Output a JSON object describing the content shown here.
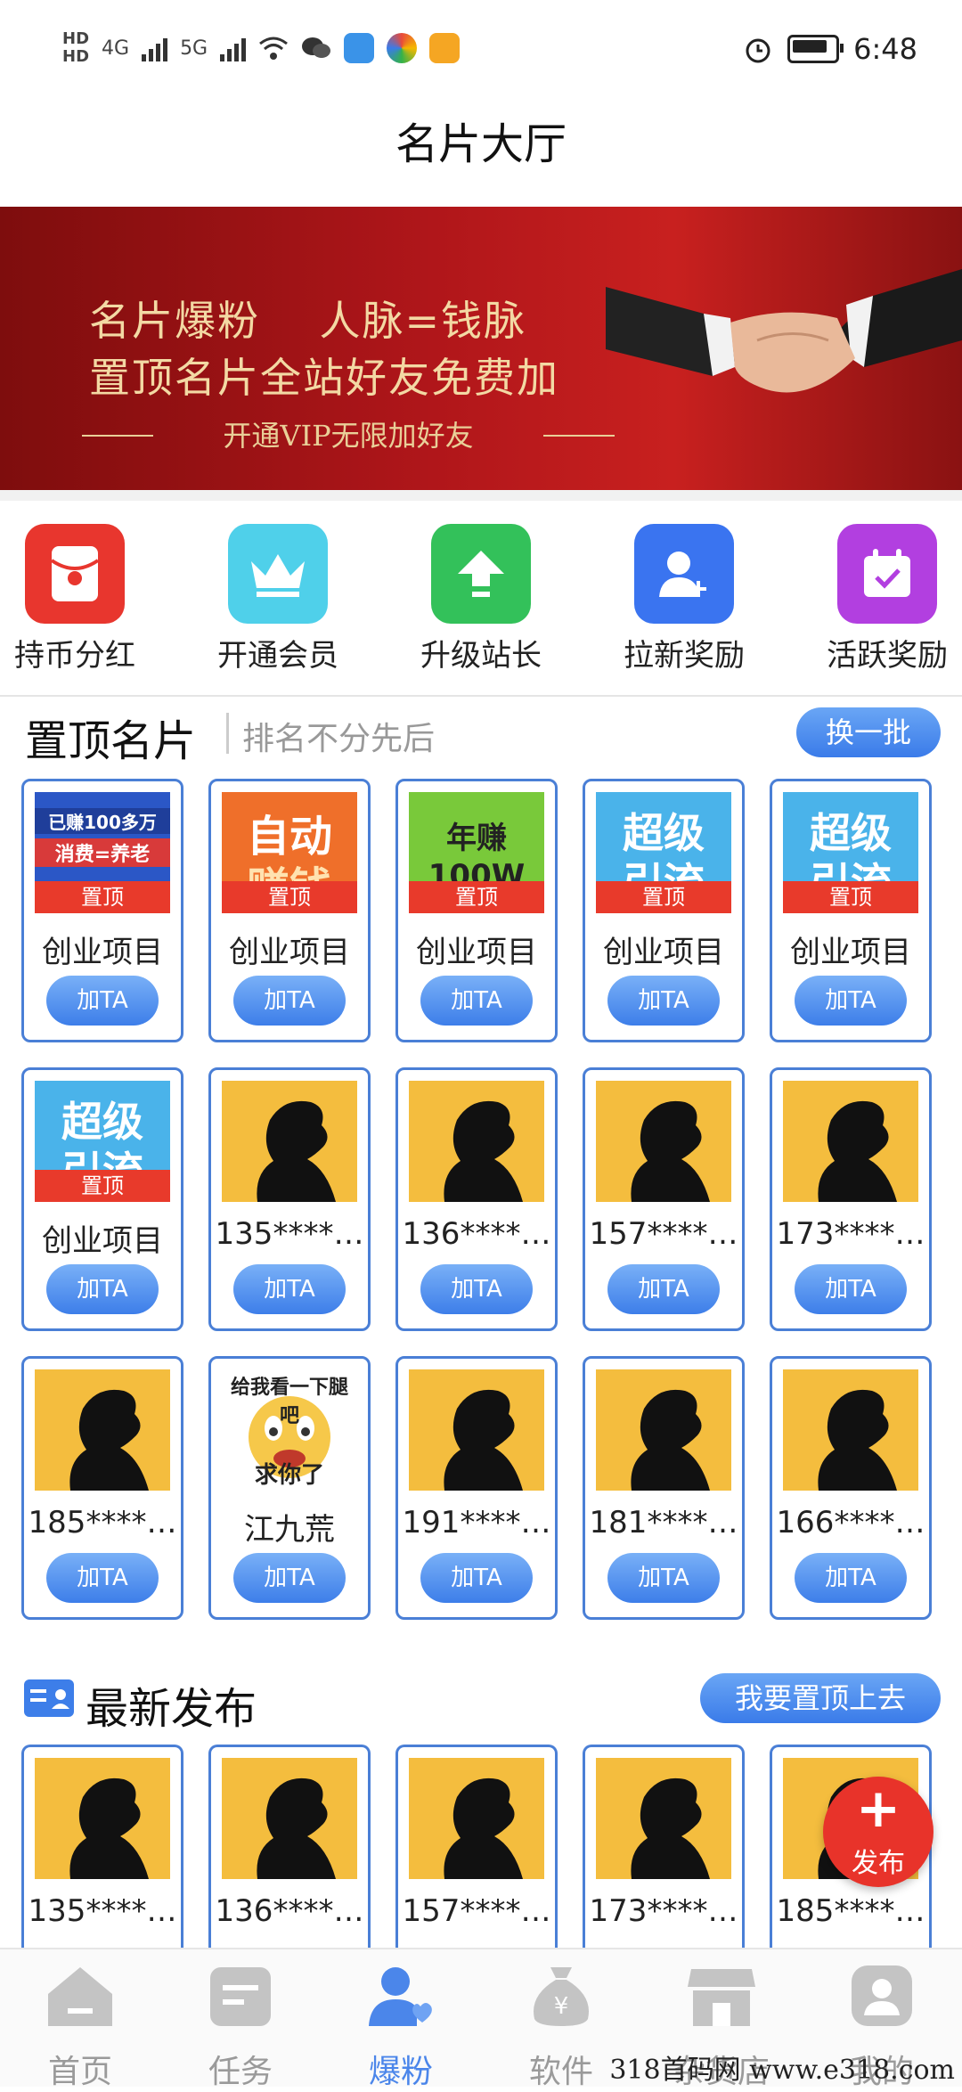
{
  "status_bar": {
    "hd1": "HD",
    "hd2": "HD",
    "net1": "4G",
    "net2": "5G",
    "time": "6:48"
  },
  "header": {
    "title": "名片大厅"
  },
  "banner": {
    "line1": "名片爆粉    人脉=钱脉",
    "line2": "置顶名片全站好友免费加",
    "line3": "开通VIP无限加好友"
  },
  "quick_actions": [
    {
      "label": "持币分红",
      "icon": "red-envelope-icon",
      "color": "#e8362e"
    },
    {
      "label": "开通会员",
      "icon": "crown-icon",
      "color": "#4fd0ea"
    },
    {
      "label": "升级站长",
      "icon": "upgrade-arrow-icon",
      "color": "#33c15a"
    },
    {
      "label": "拉新奖励",
      "icon": "add-user-icon",
      "color": "#3a74f0"
    },
    {
      "label": "活跃奖励",
      "icon": "calendar-check-icon",
      "color": "#b23fe0"
    }
  ],
  "pinned": {
    "title": "置顶名片",
    "subtitle": "排名不分先后",
    "refresh_label": "换一批",
    "cards": [
      {
        "name": "创业项目",
        "pinned_tag": "置顶",
        "add_label": "加TA",
        "promo": "已赚100多万 消费=养老"
      },
      {
        "name": "创业项目",
        "pinned_tag": "置顶",
        "add_label": "加TA",
        "promo": "自动赚钱"
      },
      {
        "name": "创业项目",
        "pinned_tag": "置顶",
        "add_label": "加TA",
        "promo": "年赚100W"
      },
      {
        "name": "创业项目",
        "pinned_tag": "置顶",
        "add_label": "加TA",
        "promo": "超级引流"
      },
      {
        "name": "创业项目",
        "pinned_tag": "置顶",
        "add_label": "加TA",
        "promo": "超级引流"
      },
      {
        "name": "创业项目",
        "pinned_tag": "置顶",
        "add_label": "加TA",
        "promo": "超级引流"
      },
      {
        "name": "135****…",
        "add_label": "加TA"
      },
      {
        "name": "136****…",
        "add_label": "加TA"
      },
      {
        "name": "157****…",
        "add_label": "加TA"
      },
      {
        "name": "173****…",
        "add_label": "加TA"
      },
      {
        "name": "185****…",
        "add_label": "加TA"
      },
      {
        "name": "江九荒",
        "add_label": "加TA",
        "promo": "给我看一下腿吧 求你了"
      },
      {
        "name": "191****…",
        "add_label": "加TA"
      },
      {
        "name": "181****…",
        "add_label": "加TA"
      },
      {
        "name": "166****…",
        "add_label": "加TA"
      }
    ]
  },
  "latest": {
    "title": "最新发布",
    "pin_cta": "我要置顶上去",
    "cards": [
      {
        "name": "135****…"
      },
      {
        "name": "136****…"
      },
      {
        "name": "157****…"
      },
      {
        "name": "173****…"
      },
      {
        "name": "185****…"
      }
    ]
  },
  "fab": {
    "plus": "+",
    "label": "发布"
  },
  "bottom_nav": [
    {
      "label": "首页",
      "icon": "home-icon"
    },
    {
      "label": "任务",
      "icon": "task-icon"
    },
    {
      "label": "爆粉",
      "icon": "fans-icon",
      "active": true
    },
    {
      "label": "软件",
      "icon": "money-bag-icon"
    },
    {
      "label": "杂货店",
      "icon": "store-icon"
    },
    {
      "label": "我的",
      "icon": "profile-icon"
    }
  ],
  "watermark": "318首码网 www.e318.com"
}
